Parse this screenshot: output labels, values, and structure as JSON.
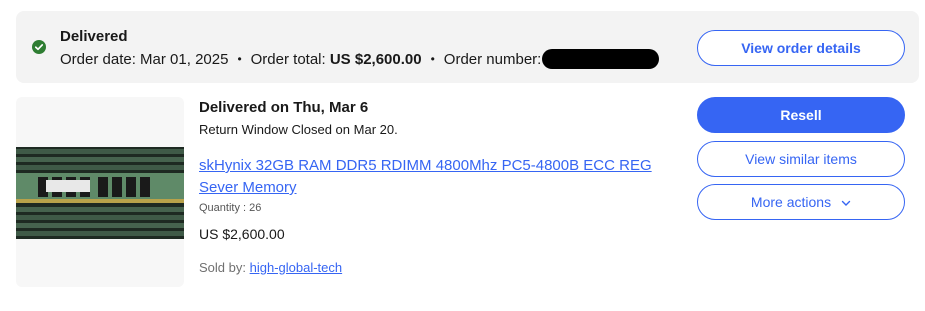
{
  "summary": {
    "status": "Delivered",
    "order_date_label": "Order date:",
    "order_date": "Mar 01, 2025",
    "order_total_label": "Order total:",
    "order_total": "US $2,600.00",
    "order_number_label": "Order number:",
    "separator": "•",
    "view_order_details": "View order details"
  },
  "item": {
    "delivery_status": "Delivered on Thu, Mar 6",
    "return_window": "Return Window Closed on Mar 20.",
    "title": "skHynix 32GB RAM DDR5 RDIMM 4800Mhz PC5-4800B ECC REG Sever Memory",
    "quantity": "Quantity : 26",
    "price": "US $2,600.00",
    "sold_by_label": "Sold by:",
    "seller": "high-global-tech"
  },
  "actions": {
    "resell": "Resell",
    "view_similar": "View similar items",
    "more_actions": "More actions"
  },
  "icons": {
    "status": "check-circle-icon",
    "more_actions": "chevron-down-icon",
    "thumbnail": "ram-module-image"
  },
  "colors": {
    "accent": "#3665f3",
    "success": "#2e7d32",
    "summary_bg": "#f3f3f3"
  }
}
